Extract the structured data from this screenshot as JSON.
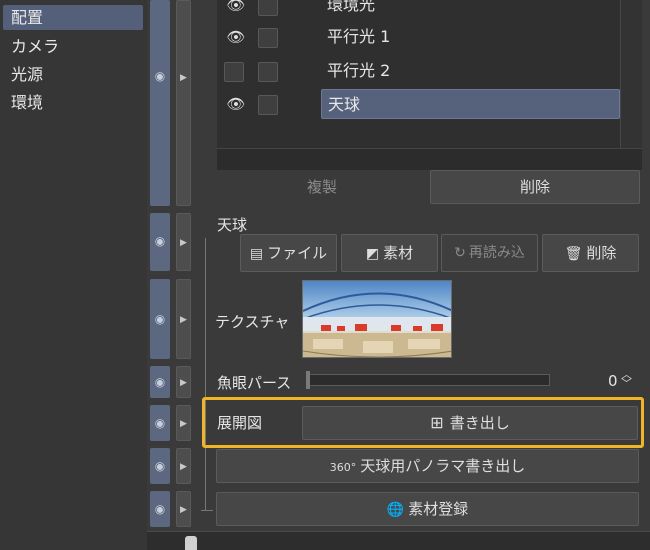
{
  "categories": [
    "配置",
    "カメラ",
    "光源",
    "環境"
  ],
  "layers": [
    {
      "name": "環境光",
      "visible": true
    },
    {
      "name": "平行光 1",
      "visible": true
    },
    {
      "name": "平行光 2",
      "visible": false
    },
    {
      "name": "天球",
      "visible": true
    }
  ],
  "list_buttons": {
    "duplicate": "複製",
    "delete": "削除"
  },
  "section_title": "天球",
  "source_buttons": {
    "file": "ファイル",
    "material": "素材",
    "reload": "再読み込",
    "delete": "削除"
  },
  "texture_label": "テクスチャ",
  "fisheye": {
    "label": "魚眼パース",
    "value": "0"
  },
  "unfold": {
    "label": "展開図",
    "button": "書き出し"
  },
  "panorama_button": "天球用パノラマ書き出し",
  "panorama_icon_text": "360°",
  "register_button": "素材登録",
  "colors": {
    "accent_highlight": "#f0b428",
    "selection": "#56627b"
  }
}
